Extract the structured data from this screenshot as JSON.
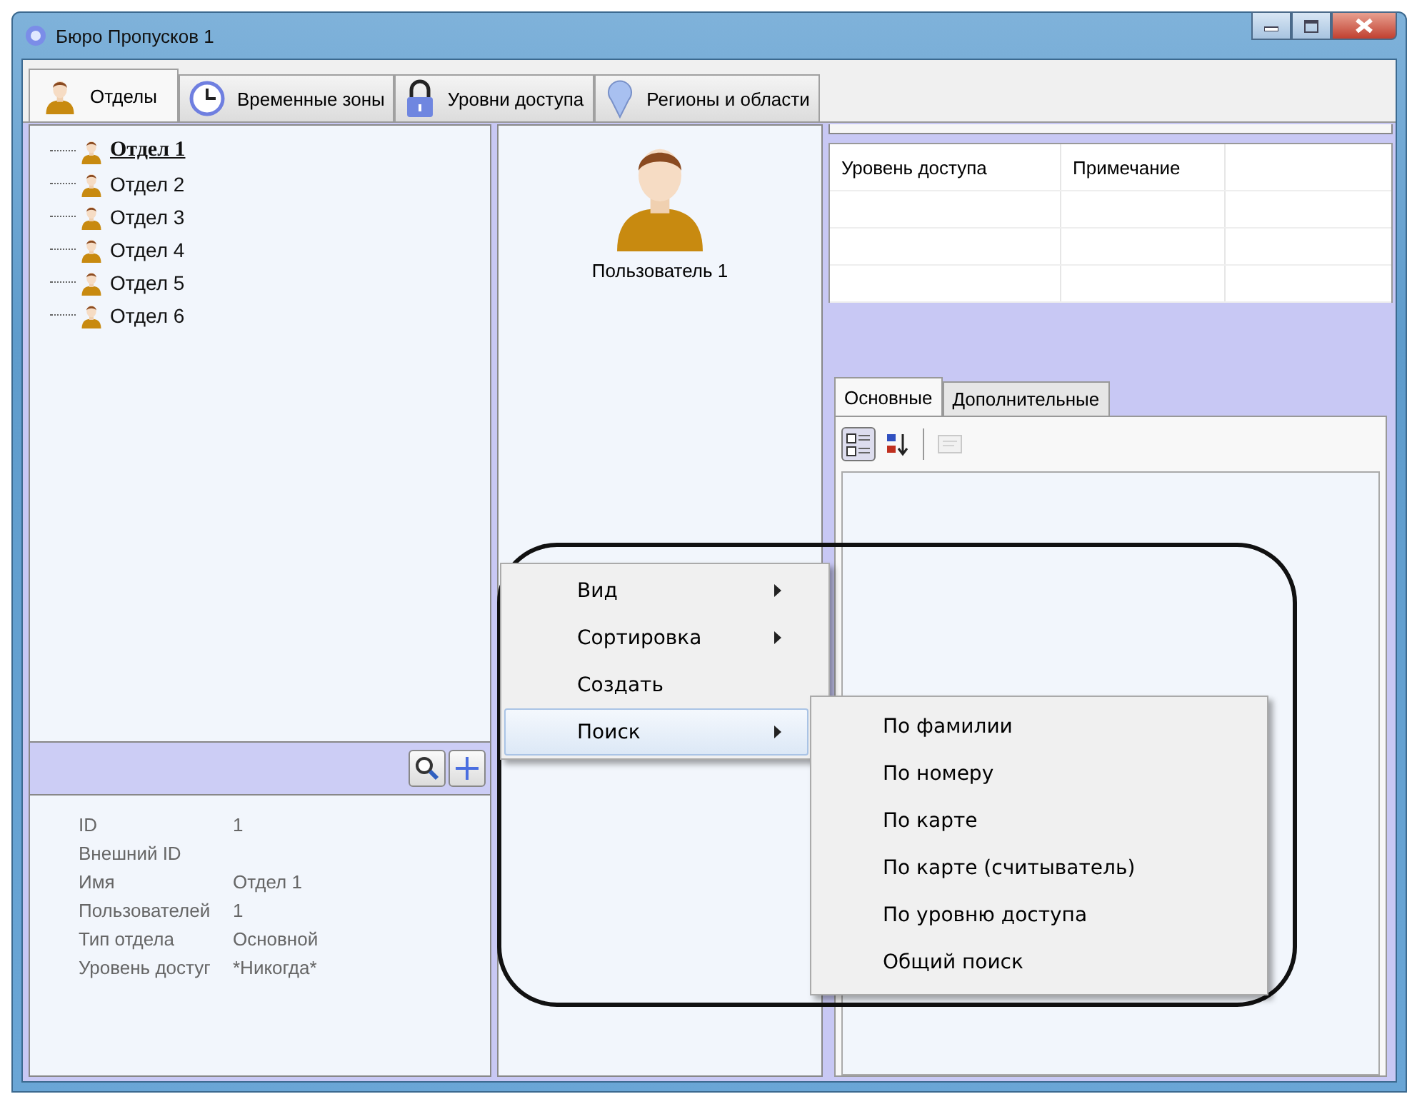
{
  "window": {
    "title": "Бюро Пропусков 1"
  },
  "tabs": [
    {
      "label": "Отделы",
      "kind": "person",
      "selected": true
    },
    {
      "label": "Временные зоны",
      "kind": "clock",
      "selected": false
    },
    {
      "label": "Уровни доступа",
      "kind": "lock",
      "selected": false
    },
    {
      "label": "Регионы и области",
      "kind": "pin",
      "selected": false
    }
  ],
  "tree": {
    "items": [
      {
        "label": "Отдел 1",
        "selected": true
      },
      {
        "label": "Отдел 2",
        "selected": false
      },
      {
        "label": "Отдел 3",
        "selected": false
      },
      {
        "label": "Отдел 4",
        "selected": false
      },
      {
        "label": "Отдел 5",
        "selected": false
      },
      {
        "label": "Отдел 6",
        "selected": false
      }
    ]
  },
  "properties": [
    {
      "name": "ID",
      "value": "1"
    },
    {
      "name": "Внешний ID"
    },
    {
      "name": "Имя",
      "value": "Отдел 1"
    },
    {
      "name": "Пользователей",
      "value": "1"
    },
    {
      "name": "Тип отдела",
      "value": "Основной"
    },
    {
      "name": "Уровень достуг",
      "value": "*Никогда*"
    }
  ],
  "user": {
    "name": "Пользователь 1"
  },
  "access_table": {
    "columns": [
      "Уровень доступа",
      "Примечание"
    ]
  },
  "detail_tabs": [
    {
      "label": "Основные",
      "selected": true
    },
    {
      "label": "Дополнительные",
      "selected": false
    }
  ],
  "property_toolbar": [
    {
      "kind": "categorized",
      "selected": true,
      "disabled": false
    },
    {
      "kind": "alphabetical",
      "selected": false,
      "disabled": false
    },
    {
      "kind": "pages",
      "selected": false,
      "disabled": true
    }
  ],
  "context_menu": {
    "items": [
      {
        "label": "Вид",
        "submenu": true,
        "selected": false
      },
      {
        "label": "Сортировка",
        "submenu": true,
        "selected": false
      },
      {
        "label": "Создать",
        "submenu": false,
        "selected": false
      },
      {
        "label": "Поиск",
        "submenu": true,
        "selected": true
      }
    ]
  },
  "submenu": {
    "items": [
      {
        "label": "По фамилии",
        "selected": false
      },
      {
        "label": "По номеру",
        "selected": false
      },
      {
        "label": "По карте",
        "selected": false
      },
      {
        "label": "По карте (считыватель)",
        "selected": false
      },
      {
        "label": "По уровню доступа",
        "selected": false
      },
      {
        "label": "Общий поиск",
        "selected": false
      }
    ]
  }
}
